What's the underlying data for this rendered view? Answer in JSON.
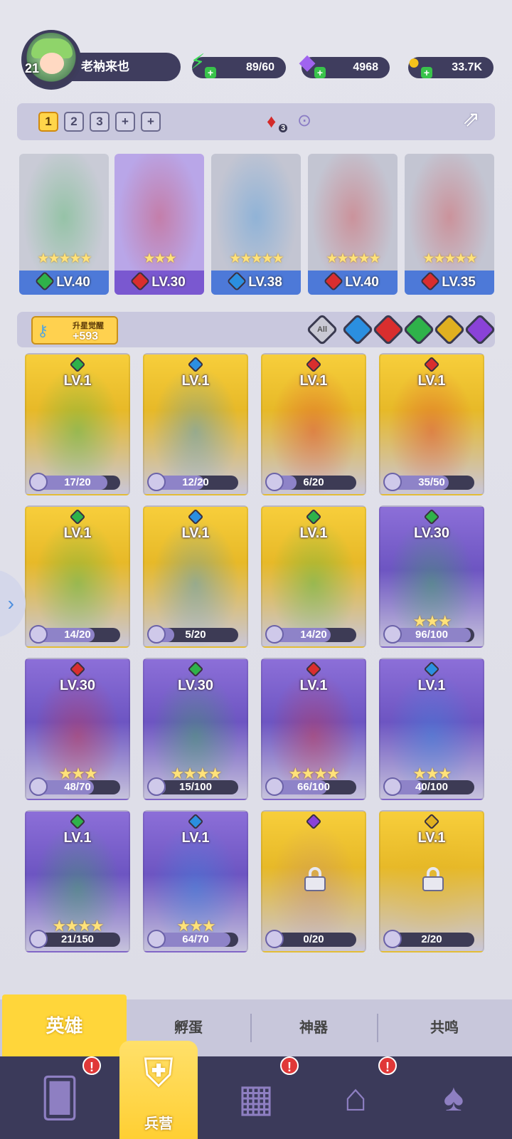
{
  "player": {
    "level": "21",
    "name": "老衲来也"
  },
  "resources": {
    "energy": "89/60",
    "gems": "4968",
    "gold": "33.7K",
    "energy_icon": "lightning-icon",
    "gem_icon": "diamond-icon",
    "gold_icon": "coin-icon"
  },
  "team": {
    "slots": [
      "1",
      "2",
      "3",
      "+",
      "+"
    ],
    "selected_slot": "1",
    "mana_count": "3",
    "heroes": [
      {
        "level": "LV.40",
        "stars": "★★★★★",
        "element": "wind",
        "bg": "#c9cbd6",
        "bar": "#4d79d8"
      },
      {
        "level": "LV.30",
        "stars": "★★★",
        "element": "fire",
        "bg": "#b9a6e8",
        "bar": "#7a58d0"
      },
      {
        "level": "LV.38",
        "stars": "★★★★★",
        "element": "water",
        "bg": "#c3c5d2",
        "bar": "#4d79d8"
      },
      {
        "level": "LV.40",
        "stars": "★★★★★",
        "element": "fire",
        "bg": "#c3c5d2",
        "bar": "#4d79d8"
      },
      {
        "level": "LV.35",
        "stars": "★★★★★",
        "element": "fire",
        "bg": "#c3c5d2",
        "bar": "#4d79d8"
      }
    ]
  },
  "awaken": {
    "label": "升星觉醒",
    "value": "+593"
  },
  "filters": {
    "all": "All",
    "elements": [
      "water",
      "fire",
      "wind",
      "light",
      "dark"
    ]
  },
  "element_colors": {
    "wind": "#2fb24a",
    "fire": "#d92e2e",
    "water": "#2b8fe0",
    "light": "#e0b020",
    "dark": "#8a42d8"
  },
  "heroes": [
    {
      "level": "LV.1",
      "progress": "17/20",
      "fraction": 0.85,
      "stars": "",
      "rarity": "gold",
      "element": "wind",
      "locked": false
    },
    {
      "level": "LV.1",
      "progress": "12/20",
      "fraction": 0.6,
      "stars": "",
      "rarity": "gold",
      "element": "water",
      "locked": false
    },
    {
      "level": "LV.1",
      "progress": "6/20",
      "fraction": 0.3,
      "stars": "",
      "rarity": "gold",
      "element": "fire",
      "locked": false
    },
    {
      "level": "LV.1",
      "progress": "35/50",
      "fraction": 0.7,
      "stars": "",
      "rarity": "gold",
      "element": "fire",
      "locked": false
    },
    {
      "level": "LV.1",
      "progress": "14/20",
      "fraction": 0.7,
      "stars": "",
      "rarity": "gold",
      "element": "wind",
      "locked": false
    },
    {
      "level": "LV.1",
      "progress": "5/20",
      "fraction": 0.25,
      "stars": "",
      "rarity": "gold",
      "element": "water",
      "locked": false
    },
    {
      "level": "LV.1",
      "progress": "14/20",
      "fraction": 0.7,
      "stars": "",
      "rarity": "gold",
      "element": "wind",
      "locked": false
    },
    {
      "level": "LV.30",
      "progress": "96/100",
      "fraction": 0.96,
      "stars": "★★★",
      "rarity": "purple",
      "element": "wind",
      "locked": false
    },
    {
      "level": "LV.30",
      "progress": "48/70",
      "fraction": 0.69,
      "stars": "★★★",
      "rarity": "purple",
      "element": "fire",
      "locked": false
    },
    {
      "level": "LV.30",
      "progress": "15/100",
      "fraction": 0.15,
      "stars": "★★★★",
      "rarity": "purple",
      "element": "wind",
      "locked": false
    },
    {
      "level": "LV.1",
      "progress": "66/100",
      "fraction": 0.66,
      "stars": "★★★★",
      "rarity": "purple",
      "element": "fire",
      "locked": false
    },
    {
      "level": "LV.1",
      "progress": "40/100",
      "fraction": 0.4,
      "stars": "★★★",
      "rarity": "purple",
      "element": "water",
      "locked": false
    },
    {
      "level": "LV.1",
      "progress": "21/150",
      "fraction": 0.14,
      "stars": "★★★★",
      "rarity": "purple",
      "element": "wind",
      "locked": false
    },
    {
      "level": "LV.1",
      "progress": "64/70",
      "fraction": 0.91,
      "stars": "★★★",
      "rarity": "purple",
      "element": "water",
      "locked": false
    },
    {
      "level": "",
      "progress": "0/20",
      "fraction": 0.0,
      "stars": "",
      "rarity": "gold",
      "element": "dark",
      "locked": true
    },
    {
      "level": "LV.1",
      "progress": "2/20",
      "fraction": 0.1,
      "stars": "",
      "rarity": "gold",
      "element": "light",
      "locked": true
    }
  ],
  "tabs": [
    "英雄",
    "孵蛋",
    "神器",
    "共鸣"
  ],
  "nav": {
    "items": [
      {
        "icon": "cards-icon",
        "badge": "!"
      },
      {
        "icon": "barracks-icon",
        "label": "兵营",
        "badge": ""
      },
      {
        "icon": "map-icon",
        "badge": "!"
      },
      {
        "icon": "castle-icon",
        "badge": "!"
      },
      {
        "icon": "mushroom-house-icon",
        "badge": ""
      }
    ]
  }
}
